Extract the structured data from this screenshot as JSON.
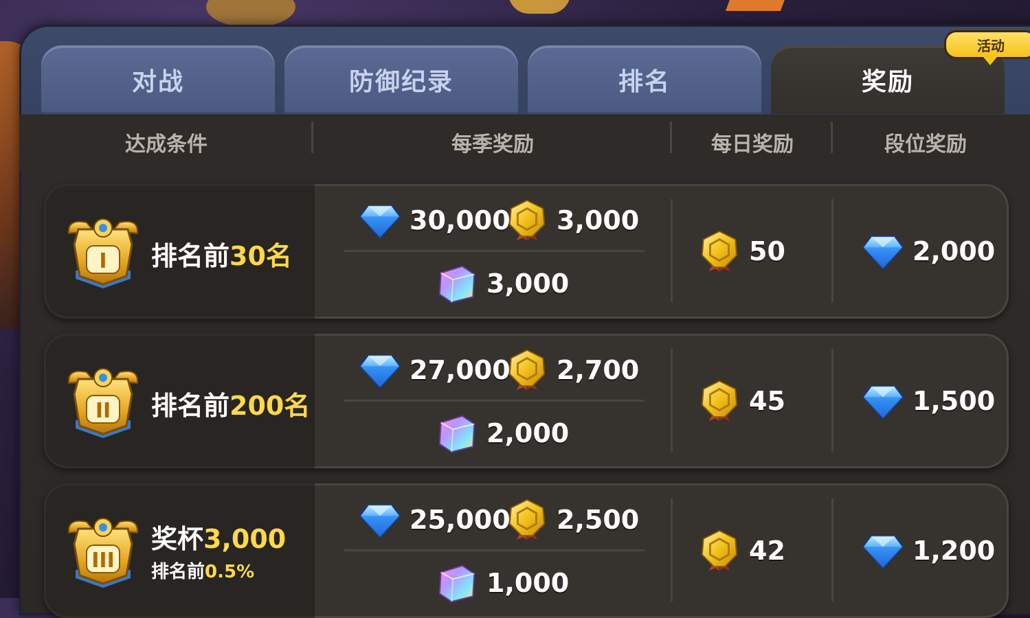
{
  "tabs": [
    {
      "label": "对战",
      "active": false
    },
    {
      "label": "防御纪录",
      "active": false
    },
    {
      "label": "排名",
      "active": false
    },
    {
      "label": "奖励",
      "active": true
    }
  ],
  "event_badge": "活动",
  "headers": {
    "condition": "达成条件",
    "season": "每季奖励",
    "daily": "每日奖励",
    "tier": "段位奖励"
  },
  "rows": [
    {
      "medal_tier": "I",
      "condition_prefix": "排名前",
      "condition_highlight": "30名",
      "condition_sub_prefix": "",
      "condition_sub_highlight": "",
      "season_gems": "30,000",
      "season_coins": "3,000",
      "season_cubes": "3,000",
      "daily_coins": "50",
      "tier_gems": "2,000"
    },
    {
      "medal_tier": "II",
      "condition_prefix": "排名前",
      "condition_highlight": "200名",
      "condition_sub_prefix": "",
      "condition_sub_highlight": "",
      "season_gems": "27,000",
      "season_coins": "2,700",
      "season_cubes": "2,000",
      "daily_coins": "45",
      "tier_gems": "1,500"
    },
    {
      "medal_tier": "III",
      "condition_prefix": "奖杯",
      "condition_highlight": "3,000",
      "condition_sub_prefix": "排名前",
      "condition_sub_highlight": "0.5%",
      "season_gems": "25,000",
      "season_coins": "2,500",
      "season_cubes": "1,000",
      "daily_coins": "42",
      "tier_gems": "1,200"
    }
  ],
  "icons": {
    "gem": "blue-diamond-icon",
    "coin": "gold-medal-coin-icon",
    "cube": "rainbow-cube-icon",
    "medal": "winged-gold-medal-icon"
  },
  "colors": {
    "highlight": "#ffd84a",
    "tab_inactive": "#4b5a82",
    "tab_active": "#33302c",
    "badge": "#f5c21b"
  }
}
